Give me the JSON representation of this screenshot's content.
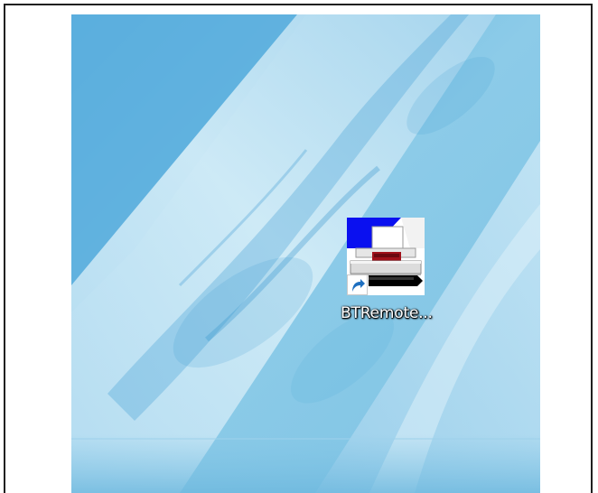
{
  "desktop": {
    "wallpaper": {
      "colors": {
        "base": "#7cc0e2",
        "light": "#cfe9f6",
        "dark": "#3f9fd3"
      }
    },
    "icons": [
      {
        "label": "BTRemote...",
        "icon": "printer-icon",
        "shortcut_overlay": "shortcut-arrow-icon",
        "colors": {
          "blue": "#0a10f0",
          "white": "#ffffff",
          "red": "#a0101a",
          "black": "#000000",
          "arrow": "#1e6fc0"
        }
      }
    ]
  }
}
